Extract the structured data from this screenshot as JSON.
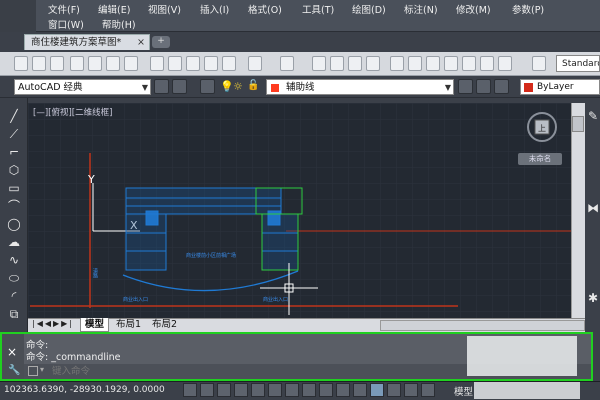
{
  "menu": {
    "row1": [
      "文件(F)",
      "编辑(E)",
      "视图(V)",
      "插入(I)",
      "格式(O)",
      "工具(T)",
      "绘图(D)",
      "标注(N)",
      "修改(M)",
      "参数(P)"
    ],
    "row2": [
      "窗口(W)",
      "帮助(H)"
    ]
  },
  "tabs": {
    "document_title": "商住楼建筑方案草图*",
    "close_glyph": "×",
    "new_tab_glyph": "+"
  },
  "toolbar": {
    "text_style": "Standard",
    "workspace": "AutoCAD 经典",
    "layer": "辅助线",
    "color": "ByLayer",
    "layer_color": "#ff3b1f",
    "color_swatch": "#d42a1a"
  },
  "viewport": {
    "label": "[—][俯视][二维线框]",
    "viewcube_face": "上",
    "viewcube_label": "未命名"
  },
  "drawing": {
    "ucs_y": "Y",
    "ucs_x": "X",
    "label_center": "商业楼前小区前相广场",
    "label_entrance_left": "商业出入口",
    "label_entrance_right": "商业出入口",
    "label_vertical": "道路"
  },
  "layout_tabs": [
    "模型",
    "布局1",
    "布局2"
  ],
  "command": {
    "history": [
      "命令:",
      "命令:  _commandline"
    ],
    "placeholder": "键入命令",
    "close_glyph": "×"
  },
  "status": {
    "coordinates": "102363.6390,  -28930.1929,  0.0000",
    "model": "模型"
  },
  "colors": {
    "canvas": "#232932",
    "building_blue": "#1f7ad4",
    "building_green": "#2ecc40",
    "axis_red": "#c0341a",
    "highlight_green": "#20d020"
  }
}
